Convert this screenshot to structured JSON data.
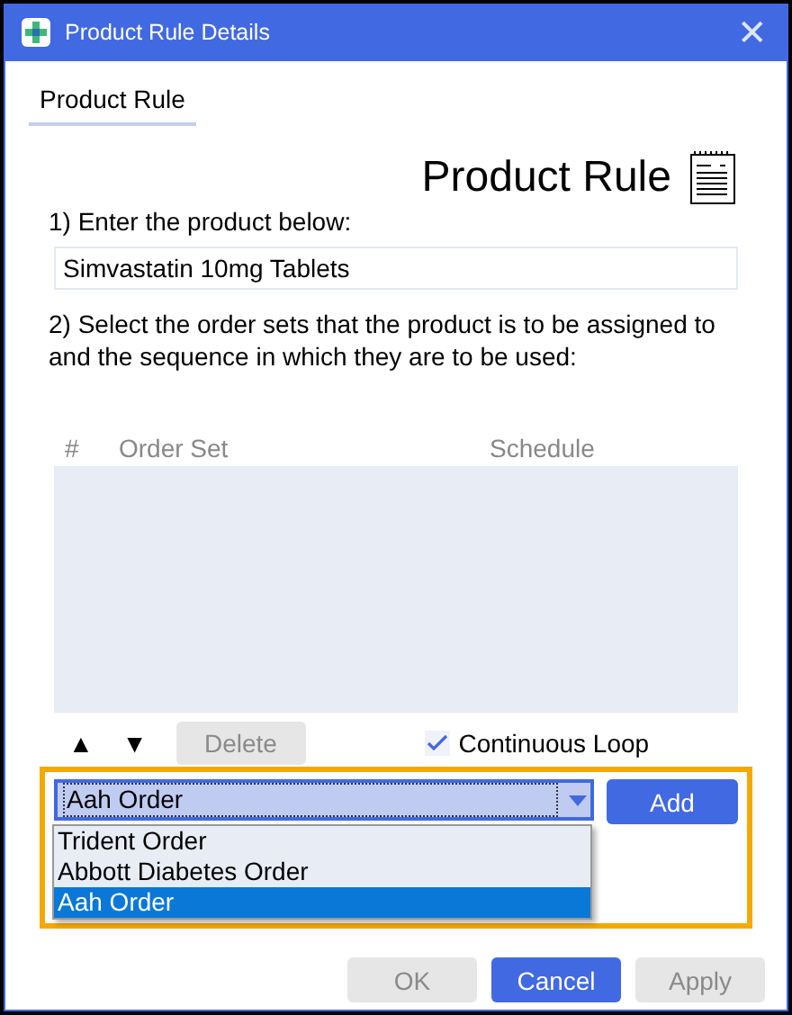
{
  "window": {
    "title": "Product Rule Details",
    "close": "✕"
  },
  "tabs": [
    {
      "label": "Product Rule",
      "selected": true
    }
  ],
  "heading": "Product Rule",
  "step1": "1) Enter the product below:",
  "product": {
    "value": "Simvastatin 10mg Tablets"
  },
  "step2": "2) Select the order sets that the product is to be assigned to and the sequence in which they are to be used:",
  "table": {
    "columns": [
      "#",
      "Order Set",
      "Schedule"
    ]
  },
  "move_up": "▲",
  "move_down": "▼",
  "delete": {
    "label": "Delete",
    "disabled": true
  },
  "continuous_loop": {
    "label": "Continuous Loop",
    "checked": true
  },
  "order_set_combo": {
    "value": "Aah Order",
    "expanded": true,
    "options": [
      {
        "label": "Trident Order",
        "selected": false
      },
      {
        "label": "Abbott Diabetes Order",
        "selected": false
      },
      {
        "label": "Aah Order",
        "selected": true
      }
    ]
  },
  "add": {
    "label": "Add",
    "disabled": false
  },
  "buttons": [
    {
      "label": "OK",
      "disabled": true
    },
    {
      "label": "Cancel",
      "disabled": false
    },
    {
      "label": "Apply",
      "disabled": true
    }
  ]
}
